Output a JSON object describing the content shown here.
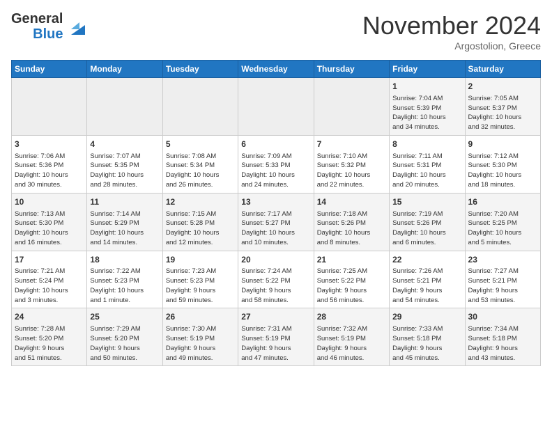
{
  "header": {
    "logo_line1": "General",
    "logo_line2": "Blue",
    "month": "November 2024",
    "location": "Argostolion, Greece"
  },
  "weekdays": [
    "Sunday",
    "Monday",
    "Tuesday",
    "Wednesday",
    "Thursday",
    "Friday",
    "Saturday"
  ],
  "weeks": [
    [
      {
        "day": "",
        "info": ""
      },
      {
        "day": "",
        "info": ""
      },
      {
        "day": "",
        "info": ""
      },
      {
        "day": "",
        "info": ""
      },
      {
        "day": "",
        "info": ""
      },
      {
        "day": "1",
        "info": "Sunrise: 7:04 AM\nSunset: 5:39 PM\nDaylight: 10 hours\nand 34 minutes."
      },
      {
        "day": "2",
        "info": "Sunrise: 7:05 AM\nSunset: 5:37 PM\nDaylight: 10 hours\nand 32 minutes."
      }
    ],
    [
      {
        "day": "3",
        "info": "Sunrise: 7:06 AM\nSunset: 5:36 PM\nDaylight: 10 hours\nand 30 minutes."
      },
      {
        "day": "4",
        "info": "Sunrise: 7:07 AM\nSunset: 5:35 PM\nDaylight: 10 hours\nand 28 minutes."
      },
      {
        "day": "5",
        "info": "Sunrise: 7:08 AM\nSunset: 5:34 PM\nDaylight: 10 hours\nand 26 minutes."
      },
      {
        "day": "6",
        "info": "Sunrise: 7:09 AM\nSunset: 5:33 PM\nDaylight: 10 hours\nand 24 minutes."
      },
      {
        "day": "7",
        "info": "Sunrise: 7:10 AM\nSunset: 5:32 PM\nDaylight: 10 hours\nand 22 minutes."
      },
      {
        "day": "8",
        "info": "Sunrise: 7:11 AM\nSunset: 5:31 PM\nDaylight: 10 hours\nand 20 minutes."
      },
      {
        "day": "9",
        "info": "Sunrise: 7:12 AM\nSunset: 5:30 PM\nDaylight: 10 hours\nand 18 minutes."
      }
    ],
    [
      {
        "day": "10",
        "info": "Sunrise: 7:13 AM\nSunset: 5:30 PM\nDaylight: 10 hours\nand 16 minutes."
      },
      {
        "day": "11",
        "info": "Sunrise: 7:14 AM\nSunset: 5:29 PM\nDaylight: 10 hours\nand 14 minutes."
      },
      {
        "day": "12",
        "info": "Sunrise: 7:15 AM\nSunset: 5:28 PM\nDaylight: 10 hours\nand 12 minutes."
      },
      {
        "day": "13",
        "info": "Sunrise: 7:17 AM\nSunset: 5:27 PM\nDaylight: 10 hours\nand 10 minutes."
      },
      {
        "day": "14",
        "info": "Sunrise: 7:18 AM\nSunset: 5:26 PM\nDaylight: 10 hours\nand 8 minutes."
      },
      {
        "day": "15",
        "info": "Sunrise: 7:19 AM\nSunset: 5:26 PM\nDaylight: 10 hours\nand 6 minutes."
      },
      {
        "day": "16",
        "info": "Sunrise: 7:20 AM\nSunset: 5:25 PM\nDaylight: 10 hours\nand 5 minutes."
      }
    ],
    [
      {
        "day": "17",
        "info": "Sunrise: 7:21 AM\nSunset: 5:24 PM\nDaylight: 10 hours\nand 3 minutes."
      },
      {
        "day": "18",
        "info": "Sunrise: 7:22 AM\nSunset: 5:23 PM\nDaylight: 10 hours\nand 1 minute."
      },
      {
        "day": "19",
        "info": "Sunrise: 7:23 AM\nSunset: 5:23 PM\nDaylight: 9 hours\nand 59 minutes."
      },
      {
        "day": "20",
        "info": "Sunrise: 7:24 AM\nSunset: 5:22 PM\nDaylight: 9 hours\nand 58 minutes."
      },
      {
        "day": "21",
        "info": "Sunrise: 7:25 AM\nSunset: 5:22 PM\nDaylight: 9 hours\nand 56 minutes."
      },
      {
        "day": "22",
        "info": "Sunrise: 7:26 AM\nSunset: 5:21 PM\nDaylight: 9 hours\nand 54 minutes."
      },
      {
        "day": "23",
        "info": "Sunrise: 7:27 AM\nSunset: 5:21 PM\nDaylight: 9 hours\nand 53 minutes."
      }
    ],
    [
      {
        "day": "24",
        "info": "Sunrise: 7:28 AM\nSunset: 5:20 PM\nDaylight: 9 hours\nand 51 minutes."
      },
      {
        "day": "25",
        "info": "Sunrise: 7:29 AM\nSunset: 5:20 PM\nDaylight: 9 hours\nand 50 minutes."
      },
      {
        "day": "26",
        "info": "Sunrise: 7:30 AM\nSunset: 5:19 PM\nDaylight: 9 hours\nand 49 minutes."
      },
      {
        "day": "27",
        "info": "Sunrise: 7:31 AM\nSunset: 5:19 PM\nDaylight: 9 hours\nand 47 minutes."
      },
      {
        "day": "28",
        "info": "Sunrise: 7:32 AM\nSunset: 5:19 PM\nDaylight: 9 hours\nand 46 minutes."
      },
      {
        "day": "29",
        "info": "Sunrise: 7:33 AM\nSunset: 5:18 PM\nDaylight: 9 hours\nand 45 minutes."
      },
      {
        "day": "30",
        "info": "Sunrise: 7:34 AM\nSunset: 5:18 PM\nDaylight: 9 hours\nand 43 minutes."
      }
    ]
  ]
}
